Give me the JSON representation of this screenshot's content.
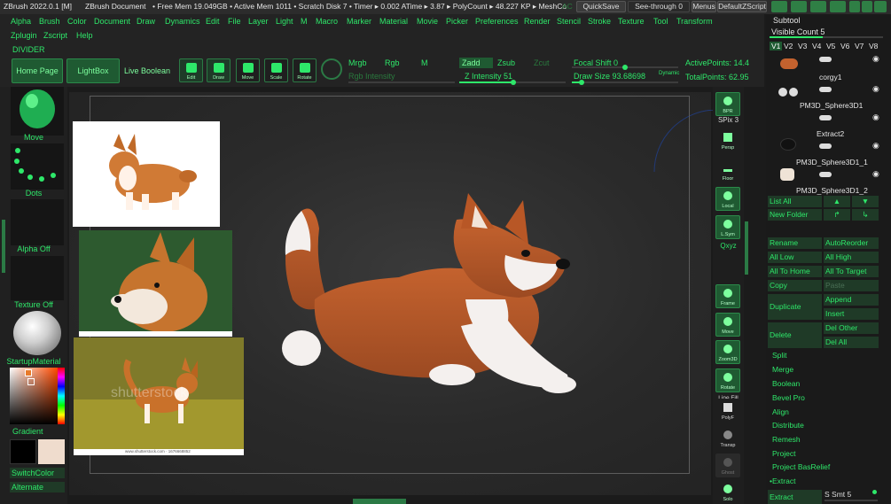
{
  "titlebar": {
    "app": "ZBrush 2022.0.1 [M]",
    "doc": "ZBrush Document",
    "stats": "• Free Mem 19.049GB • Active Mem 1011 • Scratch Disk 7 • Timer ▸ 0.002 ATime ▸ 3.87 ▸ PolyCount ▸ 48.227 KP ▸ MeshCo",
    "stats_tail": "AC",
    "quicksave": "QuickSave",
    "seethrough": "See-through  0",
    "menus": "Menus",
    "script": "DefaultZScript"
  },
  "menubar1": [
    "Alpha",
    "Brush",
    "Color",
    "Document",
    "Draw",
    "Dynamics",
    "Edit",
    "File",
    "Layer",
    "Light",
    "M",
    "Macro",
    "Marker",
    "Material",
    "Movie",
    "Picker",
    "Preferences",
    "Render",
    "Stencil",
    "Stroke",
    "Texture",
    "Tool",
    "Transform"
  ],
  "menubar2": [
    "Zplugin",
    "Zscript",
    "Help"
  ],
  "divider_label": "DIVIDER",
  "shelf": {
    "home": "Home Page",
    "lightbox": "LightBox",
    "liveboolean": "Live Boolean",
    "tools": [
      "Edit",
      "Draw",
      "Move",
      "Scale",
      "Rotate"
    ],
    "mrgb": "Mrgb",
    "rgb": "Rgb",
    "m": "M",
    "rgb_intensity": "Rgb Intensity",
    "zadd": "Zadd",
    "zsub": "Zsub",
    "zcut": "Zcut",
    "z_intensity": "Z Intensity 51",
    "z_intensity_value": 51,
    "focal_shift": "Focal Shift 0",
    "draw_size": "Draw Size 93.68698",
    "draw_size_fraction": 0.09,
    "dynamic": "Dynamic",
    "active_points": "ActivePoints: 14.4",
    "total_points": "TotalPoints: 62.95"
  },
  "leftpanel": {
    "brush": "Move",
    "stroke": "Dots",
    "alpha": "Alpha Off",
    "texture": "Texture Off",
    "material": "StartupMaterial",
    "gradient": "Gradient",
    "switchcolor": "SwitchColor",
    "alternate": "Alternate"
  },
  "canvas": {
    "watermark": "shutterstock",
    "ref_caption": "www.shutterstock.com · 1676668852"
  },
  "rightcol": {
    "bpr": "BPR",
    "spix": "SPix 3",
    "buttons": [
      "Persp",
      "Floor",
      "Local",
      "L.Sym",
      "Frame",
      "Move",
      "Zoom3D",
      "Rotate",
      "PolyF",
      "Transp",
      "Ghost",
      "Solo"
    ],
    "xyz": "Qxyz",
    "linefill": "Line Fill"
  },
  "subtool": {
    "title": "Subtool",
    "visible_count": "Visible Count 5",
    "versions": [
      "V1",
      "V2",
      "V3",
      "V4",
      "V5",
      "V6",
      "V7",
      "V8"
    ],
    "items": [
      "corgy1",
      "PM3D_Sphere3D1",
      "Extract2",
      "PM3D_Sphere3D1_1",
      "PM3D_Sphere3D1_2"
    ],
    "list_all": "List All",
    "new_folder": "New Folder",
    "rename": "Rename",
    "auto_reorder": "AutoReorder",
    "all_low": "All Low",
    "all_high": "All High",
    "all_to_home": "All To Home",
    "all_to_target": "All To Target",
    "copy": "Copy",
    "paste": "Paste",
    "duplicate": "Duplicate",
    "append": "Append",
    "insert": "Insert",
    "delete": "Delete",
    "del_other": "Del Other",
    "del_all": "Del All",
    "split": "Split",
    "merge": "Merge",
    "boolean": "Boolean",
    "bevel_pro": "Bevel Pro",
    "align": "Align",
    "distribute": "Distribute",
    "remesh": "Remesh",
    "project": "Project",
    "project_basrelief": "Project BasRelief",
    "extract_header": "Extract",
    "extract_btn": "Extract",
    "s_smt": "S Smt 5"
  }
}
